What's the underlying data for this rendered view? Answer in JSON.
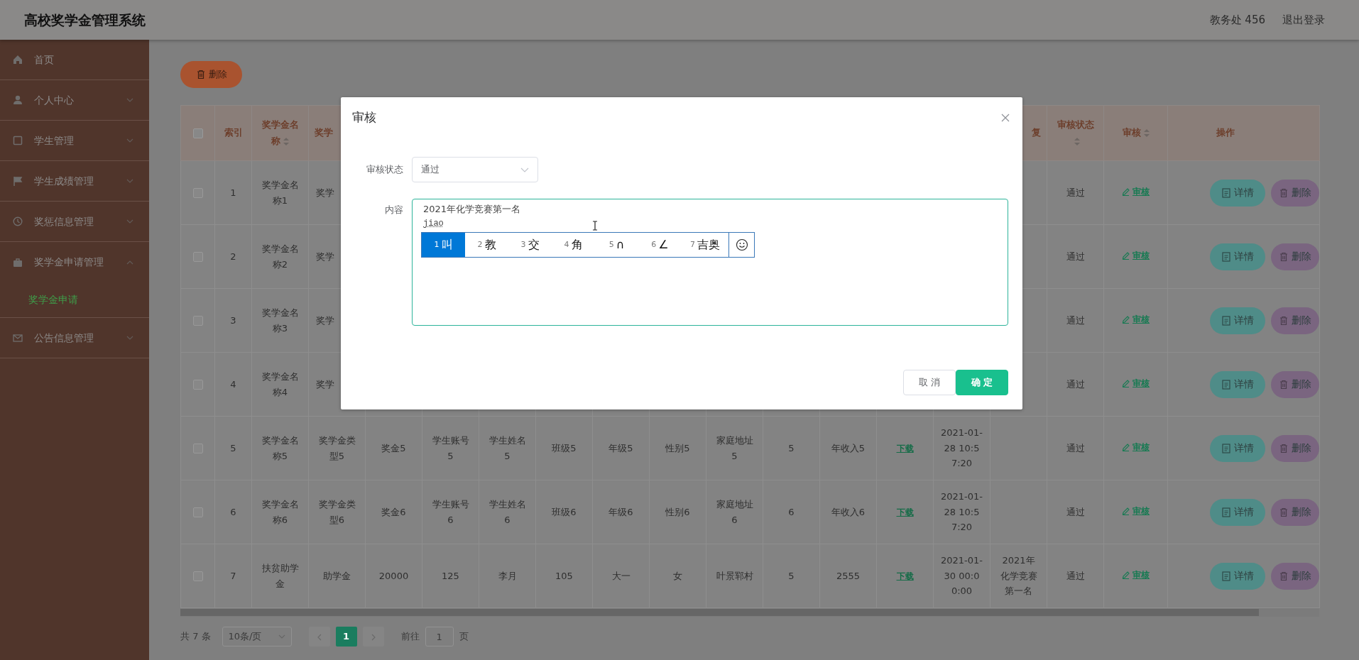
{
  "header": {
    "title": "高校奖学金管理系统",
    "user": "教务处 456",
    "logout": "退出登录"
  },
  "sidebar": {
    "items": [
      {
        "label": "首页"
      },
      {
        "label": "个人中心",
        "expanded": false
      },
      {
        "label": "学生管理",
        "expanded": false
      },
      {
        "label": "学生成绩管理",
        "expanded": false
      },
      {
        "label": "奖惩信息管理",
        "expanded": false
      },
      {
        "label": "奖学金申请管理",
        "expanded": true,
        "children": [
          {
            "label": "奖学金申请",
            "selected": true
          }
        ]
      },
      {
        "label": "公告信息管理",
        "expanded": false
      }
    ]
  },
  "toolbar": {
    "delete_button": "删除"
  },
  "table": {
    "select_all": {
      "checked": false
    },
    "columns": [
      {
        "kind": "text",
        "label": "索引",
        "sortable": false
      },
      {
        "kind": "text",
        "label": "奖学金名称",
        "sortable": true
      },
      {
        "kind": "text",
        "label": "奖学",
        "sortable": false
      },
      {
        "kind": "text"
      },
      {
        "kind": "text"
      },
      {
        "kind": "text"
      },
      {
        "kind": "text"
      },
      {
        "kind": "text"
      },
      {
        "kind": "text"
      },
      {
        "kind": "text"
      },
      {
        "kind": "text"
      },
      {
        "kind": "text"
      },
      {
        "kind": "link"
      },
      {
        "kind": "text"
      },
      {
        "kind": "text",
        "label": "复",
        "sortable": false
      },
      {
        "kind": "text",
        "label": "审核状态",
        "sortable": true
      },
      {
        "kind": "review",
        "label": "审核",
        "sortable": true
      },
      {
        "kind": "actions",
        "label": "操作",
        "sortable": false
      }
    ],
    "rows": [
      {
        "checked": false,
        "cells": [
          "1",
          "奖学金名称1",
          "奖学",
          null,
          null,
          null,
          null,
          null,
          null,
          null,
          null,
          null,
          null,
          null,
          null,
          "通过",
          "审核",
          [
            {
              "kind": "detail",
              "label": "详情"
            },
            {
              "kind": "delete",
              "label": "删除"
            }
          ]
        ]
      },
      {
        "checked": false,
        "cells": [
          "2",
          "奖学金名称2",
          "奖学",
          null,
          null,
          null,
          null,
          null,
          null,
          null,
          null,
          null,
          null,
          null,
          null,
          "通过",
          "审核",
          [
            {
              "kind": "detail",
              "label": "详情"
            },
            {
              "kind": "delete",
              "label": "删除"
            }
          ]
        ]
      },
      {
        "checked": false,
        "cells": [
          "3",
          "奖学金名称3",
          "奖学",
          null,
          null,
          null,
          null,
          null,
          null,
          null,
          null,
          null,
          null,
          null,
          null,
          "通过",
          "审核",
          [
            {
              "kind": "detail",
              "label": "详情"
            },
            {
              "kind": "delete",
              "label": "删除"
            }
          ]
        ]
      },
      {
        "checked": false,
        "cells": [
          "4",
          "奖学金名称4",
          "奖学",
          null,
          null,
          null,
          null,
          null,
          null,
          null,
          null,
          null,
          null,
          null,
          null,
          "通过",
          "审核",
          [
            {
              "kind": "detail",
              "label": "详情"
            },
            {
              "kind": "delete",
              "label": "删除"
            }
          ]
        ]
      },
      {
        "checked": false,
        "cells": [
          "5",
          "奖学金名称5",
          "奖学金类型5",
          "奖金5",
          "学生账号5",
          "学生姓名5",
          "班级5",
          "年级5",
          "性别5",
          "家庭地址5",
          "5",
          "年收入5",
          "下载",
          "2021-01-28 10:57:20",
          null,
          "通过",
          "审核",
          [
            {
              "kind": "detail",
              "label": "详情"
            },
            {
              "kind": "delete",
              "label": "删除"
            }
          ]
        ]
      },
      {
        "checked": false,
        "cells": [
          "6",
          "奖学金名称6",
          "奖学金类型6",
          "奖金6",
          "学生账号6",
          "学生姓名6",
          "班级6",
          "年级6",
          "性别6",
          "家庭地址6",
          "6",
          "年收入6",
          "下载",
          "2021-01-28 10:57:20",
          null,
          "通过",
          "审核",
          [
            {
              "kind": "detail",
              "label": "详情"
            },
            {
              "kind": "delete",
              "label": "删除"
            }
          ]
        ]
      },
      {
        "checked": false,
        "cells": [
          "7",
          "扶贫助学金",
          "助学金",
          "20000",
          "125",
          "李月",
          "105",
          "大一",
          "女",
          "叶景郓村",
          "5",
          "2555",
          "下载",
          "2021-01-30 00:00:00",
          "2021年化学竞赛第一名",
          "通过",
          "审核",
          [
            {
              "kind": "detail",
              "label": "详情"
            },
            {
              "kind": "delete",
              "label": "删除"
            }
          ]
        ]
      }
    ]
  },
  "pagination": {
    "total": "共 7 条",
    "page_size": "10条/页",
    "pages": [
      {
        "label": "1",
        "selected": true
      }
    ],
    "goto_label": "前往",
    "goto_value": "1",
    "goto_suffix": "页"
  },
  "dialog": {
    "title": "审核",
    "fields": [
      {
        "kind": "select",
        "label": "审核状态",
        "value": "通过"
      },
      {
        "kind": "textarea",
        "label": "内容",
        "lines": [
          "2021年化学竞赛第一名"
        ],
        "composition": "jiao"
      }
    ],
    "ime": {
      "candidates": [
        {
          "number": "1",
          "text": "叫",
          "selected": true
        },
        {
          "number": "2",
          "text": "教",
          "selected": false
        },
        {
          "number": "3",
          "text": "交",
          "selected": false
        },
        {
          "number": "4",
          "text": "角",
          "selected": false
        },
        {
          "number": "5",
          "text": "∩",
          "selected": false
        },
        {
          "number": "6",
          "text": "∠",
          "selected": false
        },
        {
          "number": "7",
          "text": "吉奥",
          "selected": false
        }
      ]
    },
    "buttons": [
      {
        "kind": "default",
        "label": "取 消"
      },
      {
        "kind": "primary",
        "label": "确 定"
      }
    ]
  }
}
